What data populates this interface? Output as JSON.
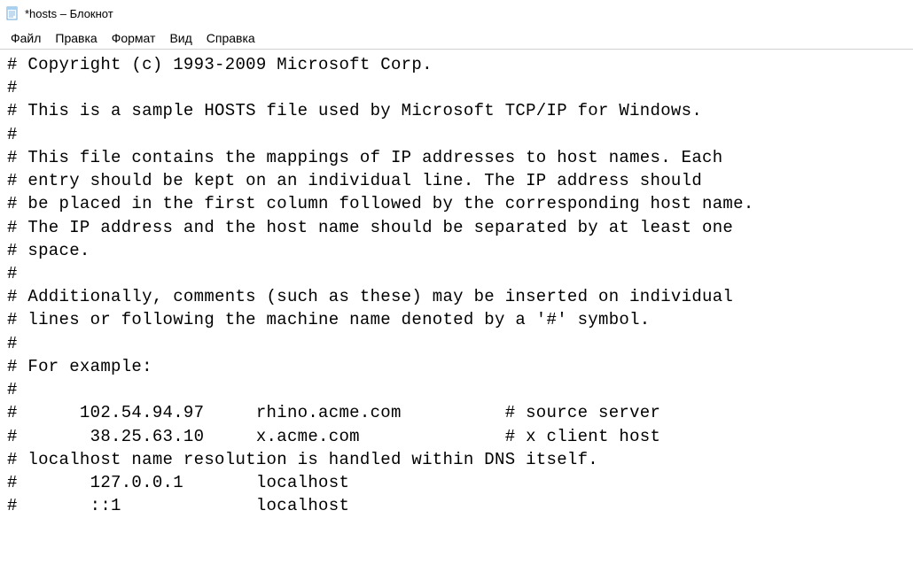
{
  "window": {
    "title": "*hosts – Блокнот"
  },
  "menu": {
    "file": "Файл",
    "edit": "Правка",
    "format": "Формат",
    "view": "Вид",
    "help": "Справка"
  },
  "content": {
    "text": "# Copyright (c) 1993-2009 Microsoft Corp.\n#\n# This is a sample HOSTS file used by Microsoft TCP/IP for Windows.\n#\n# This file contains the mappings of IP addresses to host names. Each\n# entry should be kept on an individual line. The IP address should\n# be placed in the first column followed by the corresponding host name.\n# The IP address and the host name should be separated by at least one\n# space.\n#\n# Additionally, comments (such as these) may be inserted on individual\n# lines or following the machine name denoted by a '#' symbol.\n#\n# For example:\n#\n#      102.54.94.97     rhino.acme.com          # source server\n#       38.25.63.10     x.acme.com              # x client host\n# localhost name resolution is handled within DNS itself.\n#       127.0.0.1       localhost\n#       ::1             localhost"
  }
}
